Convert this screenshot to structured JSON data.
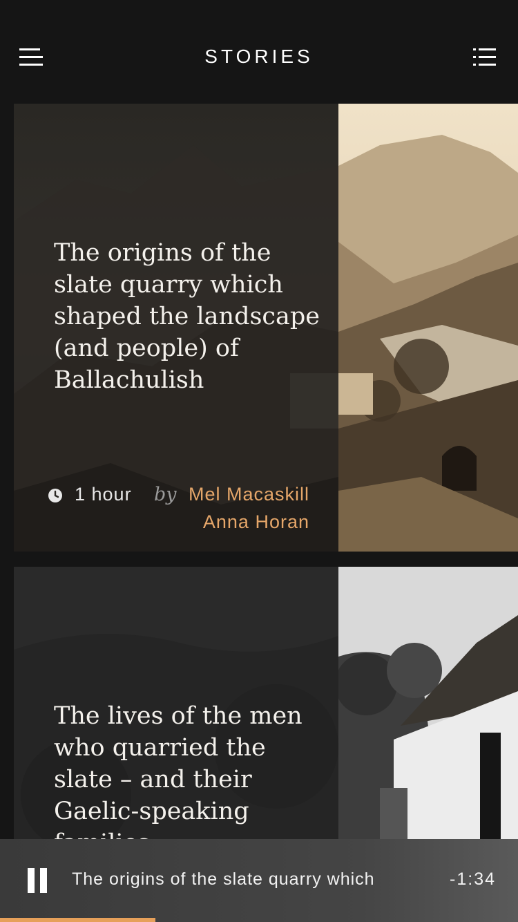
{
  "header": {
    "title": "STORIES",
    "menu_icon": "hamburger-menu-icon",
    "list_icon": "list-view-icon"
  },
  "stories": [
    {
      "title": "The origins of the slate quarry which shaped the landscape (and people) of Ballachulish",
      "duration": "1 hour",
      "by_label": "by",
      "authors": [
        "Mel Macaskill",
        "Anna Horan"
      ],
      "clock_icon": "clock-icon"
    },
    {
      "title": "The lives of the men who quarried the slate – and their Gaelic-speaking families"
    }
  ],
  "player": {
    "title": "The origins of the slate quarry which",
    "time_remaining": "-1:34",
    "pause_icon": "pause-icon",
    "progress_fraction": 0.3
  },
  "colors": {
    "background": "#151515",
    "accent": "#e6a05a",
    "author": "#e6a76a"
  }
}
